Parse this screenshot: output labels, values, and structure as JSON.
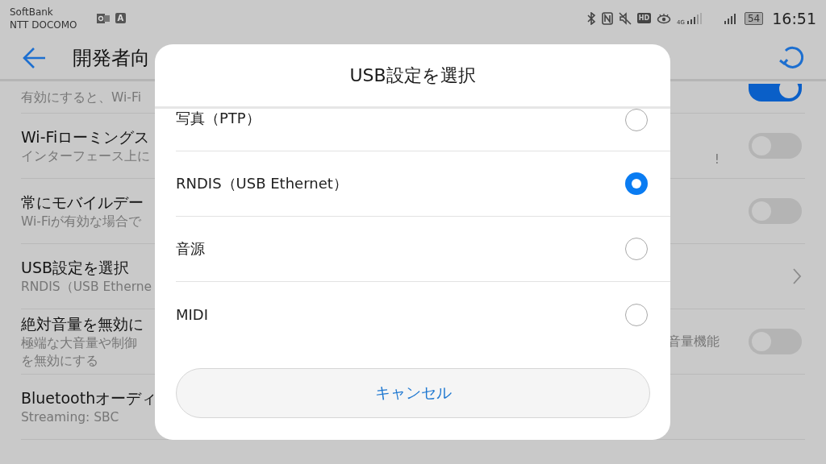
{
  "status_bar": {
    "carriers": [
      "SoftBank",
      "NTT DOCOMO"
    ],
    "app_badge": "A",
    "hd": "HD",
    "network": "4G",
    "battery": "54",
    "time": "16:51"
  },
  "header": {
    "title": "開発者向"
  },
  "settings": [
    {
      "kind": "toggle",
      "subtitle_lines": [
        "有効にすると、Wi-Fi"
      ],
      "on": true,
      "partial": true
    },
    {
      "kind": "toggle",
      "title": "Wi-Fiローミングス",
      "subtitle_lines": [
        "インターフェース上に"
      ],
      "right_text": "!",
      "on": false
    },
    {
      "kind": "toggle",
      "title": "常にモバイルデー",
      "subtitle_lines": [
        "Wi-Fiが有効な場合で"
      ],
      "on": false
    },
    {
      "kind": "chevron",
      "title": "USB設定を選択",
      "subtitle_lines": [
        "RNDIS（USB Etherne"
      ]
    },
    {
      "kind": "toggle",
      "title": "絶対音量を無効に",
      "subtitle_lines": [
        "極端な大音量や制御",
        "を無効にする"
      ],
      "right_text": "音量機能",
      "on": false
    },
    {
      "kind": "plain",
      "title": "Bluetoothオーディ",
      "subtitle_lines": [
        "Streaming: SBC"
      ]
    }
  ],
  "dialog": {
    "title": "USB設定を選択",
    "options": [
      {
        "label": "写真（PTP）",
        "selected": false,
        "partial": true
      },
      {
        "label": "RNDIS（USB Ethernet）",
        "selected": true
      },
      {
        "label": "音源",
        "selected": false
      },
      {
        "label": "MIDI",
        "selected": false
      }
    ],
    "cancel": "キャンセル"
  }
}
